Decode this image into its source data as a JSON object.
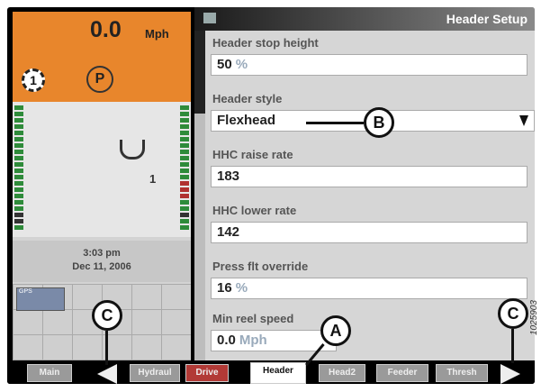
{
  "status": {
    "speed_value": "0.0",
    "speed_unit": "Mph",
    "gear": "1",
    "park_symbol": "P",
    "header_number": "1",
    "time": "3:03 pm",
    "date": "Dec 11, 2006",
    "gps_label": "GPS"
  },
  "panel": {
    "title": "Header Setup",
    "fields": [
      {
        "label": "Header stop height",
        "value": "50",
        "unit": "%"
      },
      {
        "label": "Header style",
        "value": "Flexhead"
      },
      {
        "label": "HHC raise rate",
        "value": "183"
      },
      {
        "label": "HHC lower rate",
        "value": "142"
      },
      {
        "label": "Press flt override",
        "value": "16",
        "unit": "%"
      },
      {
        "label": "Min reel speed",
        "value": "0.0",
        "unit": "Mph"
      }
    ]
  },
  "tabs": [
    "Main",
    "Hydraul",
    "Drive",
    "Header",
    "Head2",
    "Feeder",
    "Thresh"
  ],
  "active_tab": "Header",
  "callouts": {
    "a": "A",
    "b": "B",
    "c": "C"
  },
  "figure_id": "1025903",
  "colors": {
    "status_orange": "#e8862c",
    "drive_tab": "#b23a36"
  }
}
